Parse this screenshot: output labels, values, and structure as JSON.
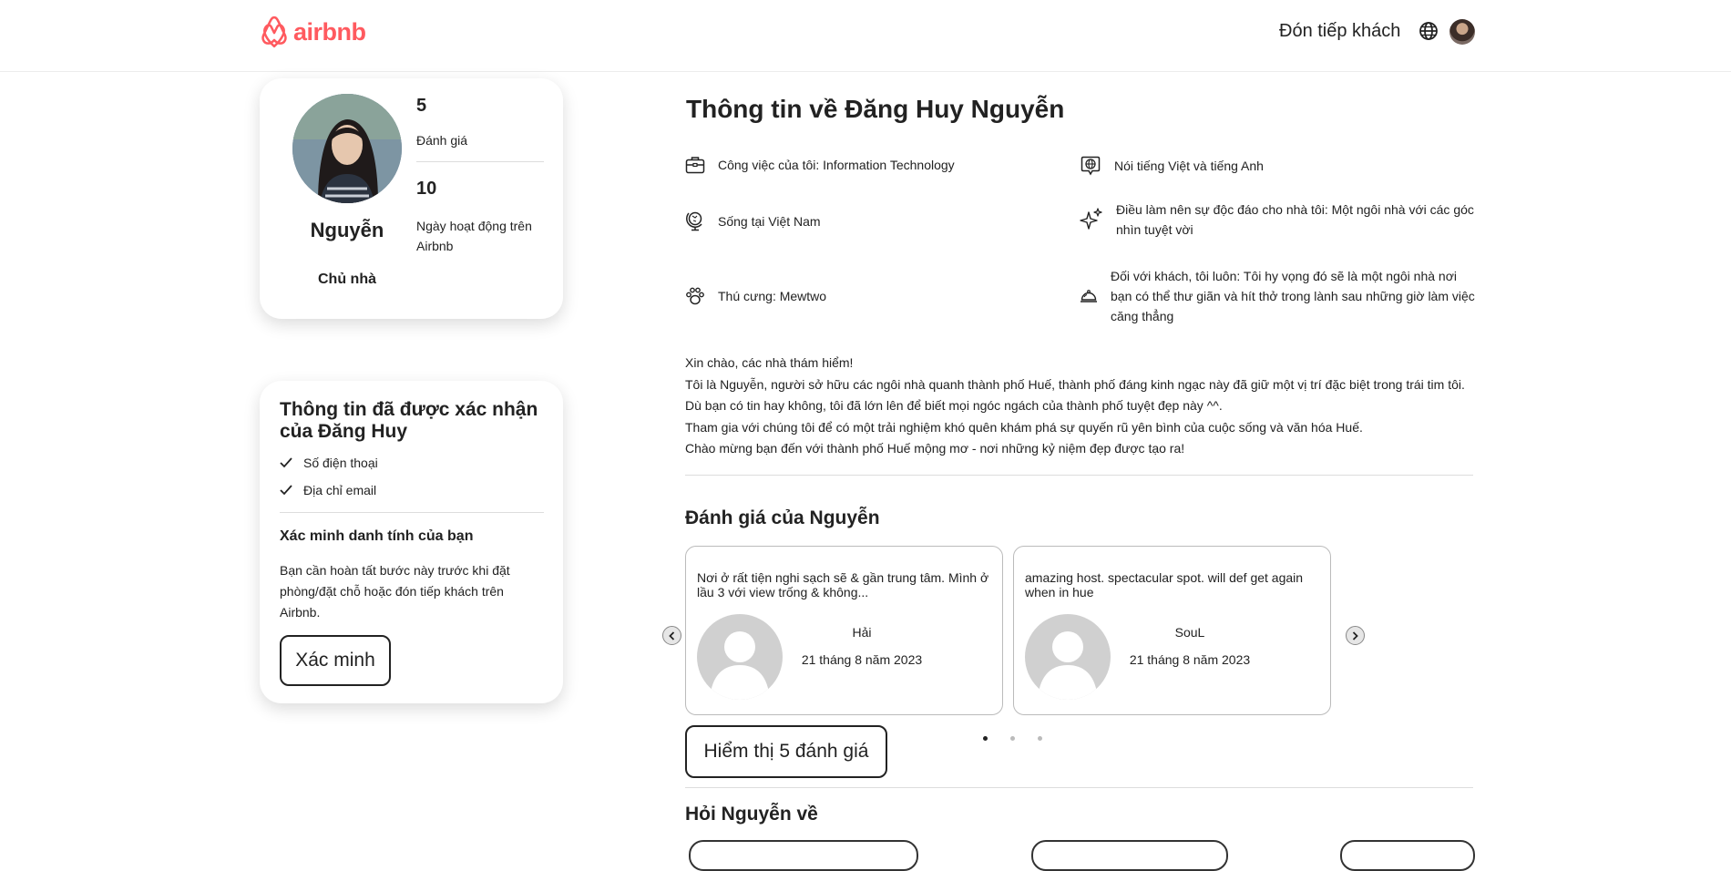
{
  "header": {
    "logo_text": "airbnb",
    "host_link": "Đón tiếp khách",
    "brand_color": "#ff5a5f"
  },
  "profile": {
    "name": "Nguyễn",
    "role": "Chủ nhà",
    "stats": [
      {
        "value": "5",
        "label": "Đánh giá"
      },
      {
        "value": "10",
        "label": "Ngày hoạt động trên Airbnb"
      }
    ]
  },
  "verification": {
    "title": "Thông tin đã được xác nhận của Đăng Huy",
    "items": [
      "Số điện thoại",
      "Địa chỉ email"
    ],
    "subtitle": "Xác minh danh tính của bạn",
    "description": "Bạn cần hoàn tất bước này trước khi đặt phòng/đặt chỗ hoặc đón tiếp khách trên Airbnb.",
    "button": "Xác minh"
  },
  "about": {
    "title": "Thông tin về Đăng Huy Nguyễn",
    "work": "Công việc của tôi: Information Technology",
    "languages": "Nói tiếng Việt và tiếng Anh",
    "lives": "Sống tại Việt Nam",
    "unique": "Điều làm nên sự độc đáo cho nhà tôi: Một ngôi nhà với các góc nhìn tuyệt vời",
    "pets": "Thú cưng: Mewtwo",
    "guests": "Đối với khách, tôi luôn: Tôi hy vọng đó sẽ là một ngôi nhà nơi bạn có thể thư giãn và hít thở trong lành sau những giờ làm việc căng thẳng",
    "bio": [
      "Xin chào, các nhà thám hiểm!",
      "Tôi là Nguyễn, người sở hữu các ngôi nhà quanh thành phố Huế, thành phố đáng kinh ngạc này đã giữ một vị trí đặc biệt trong trái tim tôi.",
      "Dù bạn có tin hay không, tôi đã lớn lên để biết mọi ngóc ngách của thành phố tuyệt đẹp này ^^.",
      "Tham gia với chúng tôi để có một trải nghiệm khó quên khám phá sự quyến rũ yên bình của cuộc sống và văn hóa Huế.",
      "Chào mừng bạn đến với thành phố Huế mộng mơ - nơi những kỷ niệm đẹp được tạo ra!"
    ]
  },
  "reviews": {
    "title": "Đánh giá của Nguyễn",
    "items": [
      {
        "text": "Nơi ở rất tiện nghi sạch sẽ & gần trung tâm. Mình ở lầu 3 với view trống & không...",
        "name": "Hải",
        "date": "21 tháng 8 năm 2023"
      },
      {
        "text": "amazing host. spectacular spot. will def get again when in hue",
        "name": "SouL",
        "date": "21 tháng 8 năm 2023"
      }
    ],
    "pagination_active": 1,
    "pagination_total": 3,
    "show_button": "Hiểm thị 5 đánh giá"
  },
  "ask": {
    "title": "Hỏi Nguyễn về"
  }
}
